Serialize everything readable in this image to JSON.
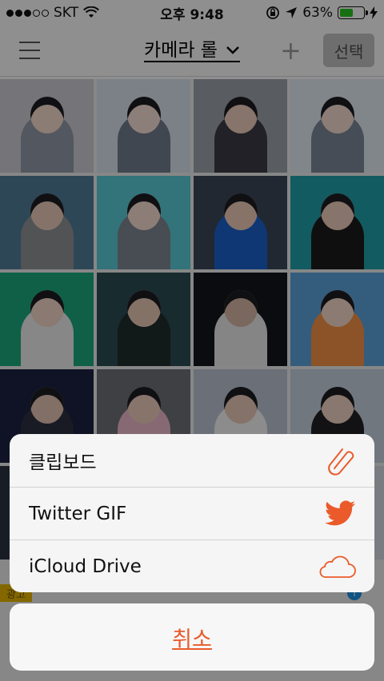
{
  "status_bar": {
    "carrier": "SKT",
    "time": "오후 9:48",
    "battery_percent": "63%",
    "battery_level": 0.63
  },
  "nav": {
    "title": "카메라 롤",
    "select_label": "선택"
  },
  "ad": {
    "badge_label": "광고"
  },
  "thumbnails": [
    {
      "bg": "#c9c9d1",
      "shirt": "#8f97a4",
      "face": "#efd6c8"
    },
    {
      "bg": "#d6dfe9",
      "shirt": "#6e7a8a",
      "face": "#f1d9cf"
    },
    {
      "bg": "#9aa0a8",
      "shirt": "#3a3a44",
      "face": "#e8c9b9"
    },
    {
      "bg": "#dfe7f0",
      "shirt": "#7b8595",
      "face": "#f0d8cc"
    },
    {
      "bg": "#4f7a96",
      "shirt": "#8c8f93",
      "face": "#e6c7b6"
    },
    {
      "bg": "#58c7d2",
      "shirt": "#7c8490",
      "face": "#f1d8cb"
    },
    {
      "bg": "#3a4656",
      "shirt": "#1b5fc9",
      "face": "#e8c6b4"
    },
    {
      "bg": "#1f9ea6",
      "shirt": "#1a1a1a",
      "face": "#e8c8b7"
    },
    {
      "bg": "#1aa57a",
      "shirt": "#e8e8e8",
      "face": "#efd2c3"
    },
    {
      "bg": "#2a4a52",
      "shirt": "#1e2b2b",
      "face": "#e6c4b2"
    },
    {
      "bg": "#14161a",
      "shirt": "#e6e6e6",
      "face": "#d3b4a4"
    },
    {
      "bg": "#5aa0d8",
      "shirt": "#f28f45",
      "face": "#f0d4c4"
    },
    {
      "bg": "#1b2240",
      "shirt": "#2b2f3f",
      "face": "#e0bfae"
    },
    {
      "bg": "#6b6f75",
      "shirt": "#e9b6c9",
      "face": "#e8c9b9"
    },
    {
      "bg": "#b8c2cf",
      "shirt": "#f1f1f1",
      "face": "#e6c6b6"
    },
    {
      "bg": "#c2cedb",
      "shirt": "#1f1f25",
      "face": "#eccfbf"
    },
    {
      "bg": "#2a3340",
      "shirt": "#555a66",
      "face": "#e2c2b1"
    },
    {
      "bg": "#8a8f98",
      "shirt": "#d9dde3",
      "face": "#e8c9b9"
    },
    {
      "bg": "#a9b4c1",
      "shirt": "#5f6670",
      "face": "#efd2c3"
    },
    {
      "bg": "#d0d6de",
      "shirt": "#3d4450",
      "face": "#ecd0c1"
    }
  ],
  "share_sheet": {
    "options": [
      {
        "label": "클립보드",
        "icon": "paperclip-icon"
      },
      {
        "label": "Twitter GIF",
        "icon": "twitter-bird-icon"
      },
      {
        "label": "iCloud Drive",
        "icon": "cloud-icon"
      }
    ],
    "cancel_label": "취소",
    "accent_color": "#ea5a2a"
  }
}
